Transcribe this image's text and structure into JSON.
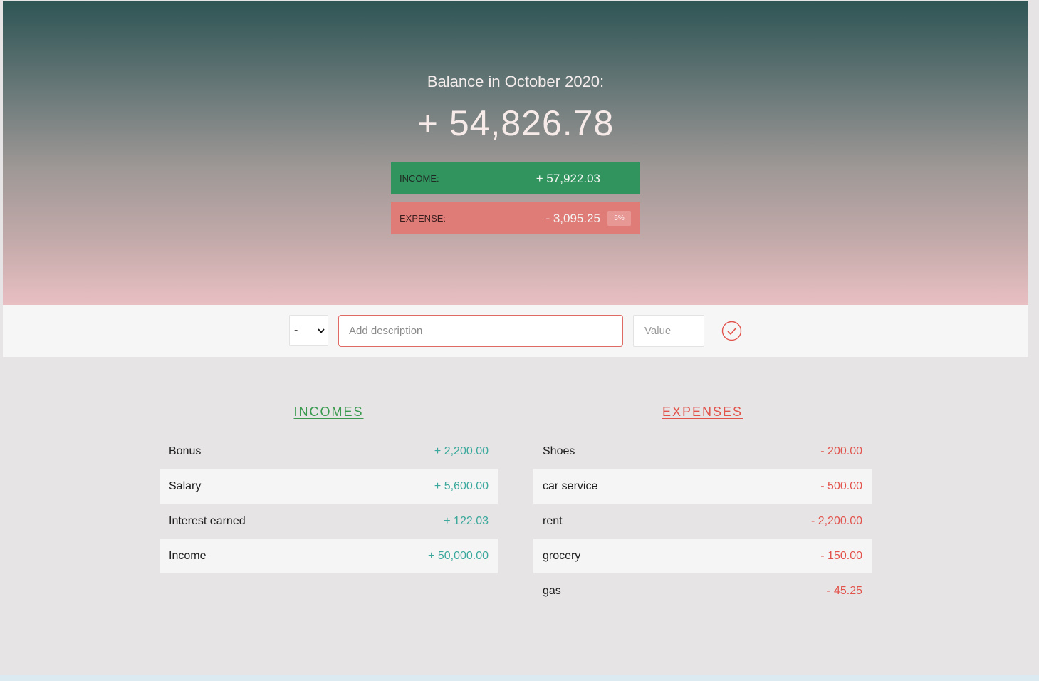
{
  "header": {
    "balance_title": "Balance in October 2020:",
    "balance_value": "+ 54,826.78",
    "income": {
      "label": "Income:",
      "value": "+ 57,922.03"
    },
    "expense": {
      "label": "Expense:",
      "value": "- 3,095.25",
      "percentage": "5%"
    }
  },
  "add_bar": {
    "type_selected": "-",
    "description_placeholder": "Add description",
    "value_placeholder": "Value",
    "confirm_icon": "checkmark-circle-icon"
  },
  "incomes": {
    "title": "Incomes",
    "items": [
      {
        "description": "Bonus",
        "value": "+ 2,200.00"
      },
      {
        "description": "Salary",
        "value": "+ 5,600.00"
      },
      {
        "description": "Interest earned",
        "value": "+ 122.03"
      },
      {
        "description": "Income",
        "value": "+ 50,000.00"
      }
    ]
  },
  "expenses": {
    "title": "Expenses",
    "items": [
      {
        "description": "Shoes",
        "value": "- 200.00"
      },
      {
        "description": "car service",
        "value": "- 500.00"
      },
      {
        "description": "rent",
        "value": "- 2,200.00"
      },
      {
        "description": "grocery",
        "value": "- 150.00"
      },
      {
        "description": "gas",
        "value": "- 45.25"
      }
    ]
  },
  "colors": {
    "income_accent": "#31945e",
    "expense_accent": "#e07c78",
    "income_text": "#3aa89c",
    "expense_text": "#e2534c"
  }
}
